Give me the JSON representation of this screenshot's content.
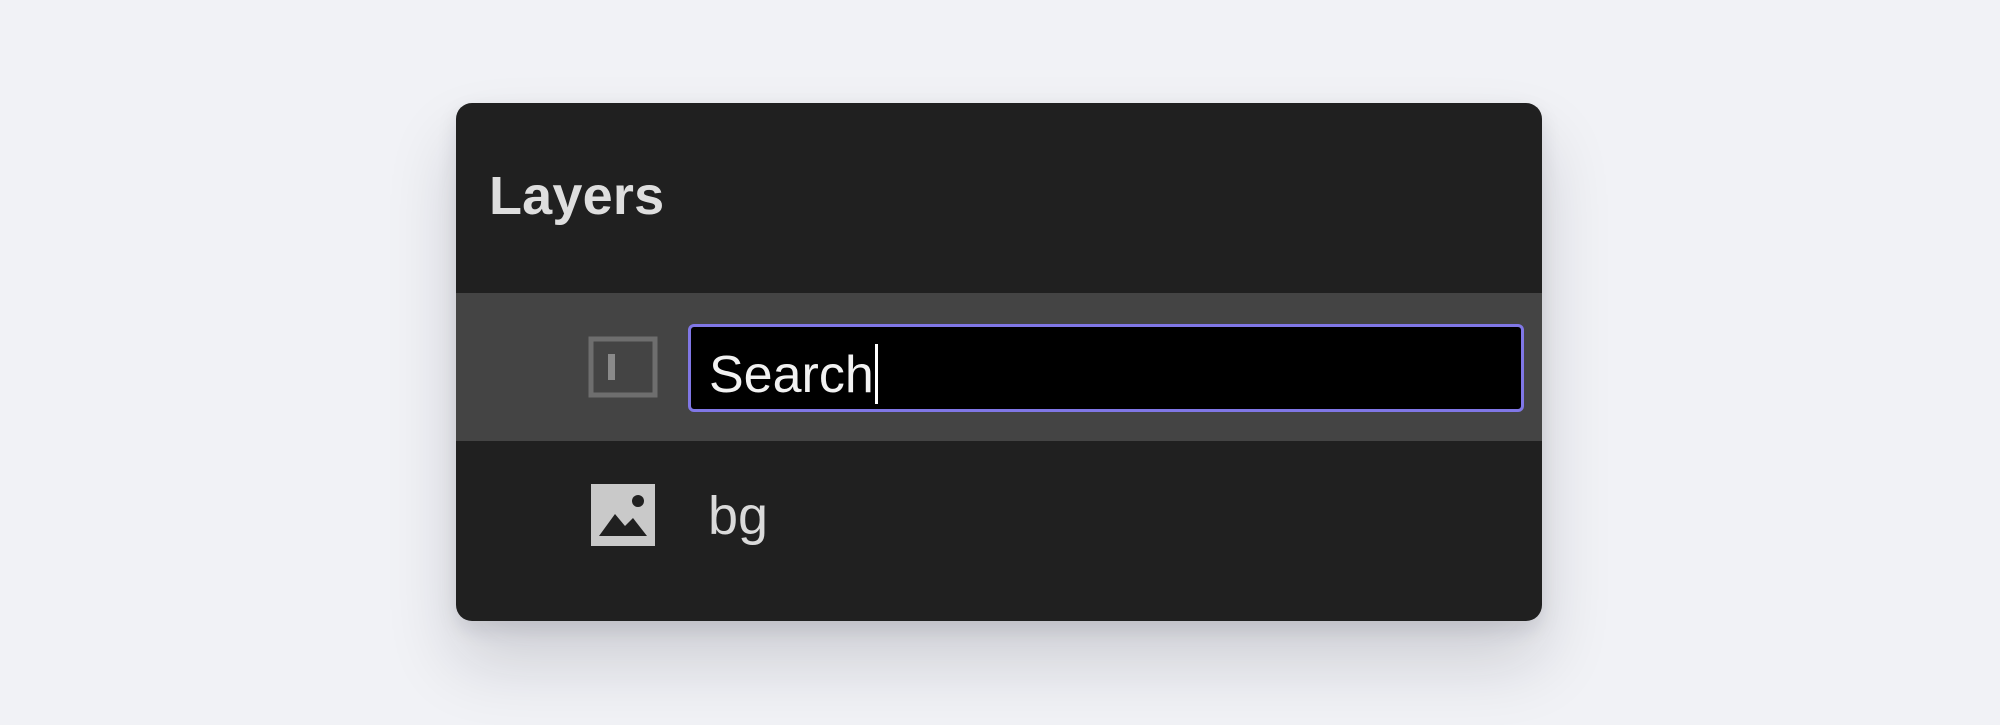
{
  "panel": {
    "title": "Layers"
  },
  "layers": [
    {
      "name": "Search",
      "icon": "text-frame-icon",
      "state": "renaming",
      "selected": true
    },
    {
      "name": "bg",
      "icon": "image-icon",
      "state": "normal",
      "selected": false
    }
  ],
  "colors": {
    "page_background": "#f1f2f6",
    "panel_background": "#202020",
    "selected_row": "#444444",
    "input_background": "#000000",
    "input_focus_border": "#8077e6",
    "text": "#dedede"
  }
}
